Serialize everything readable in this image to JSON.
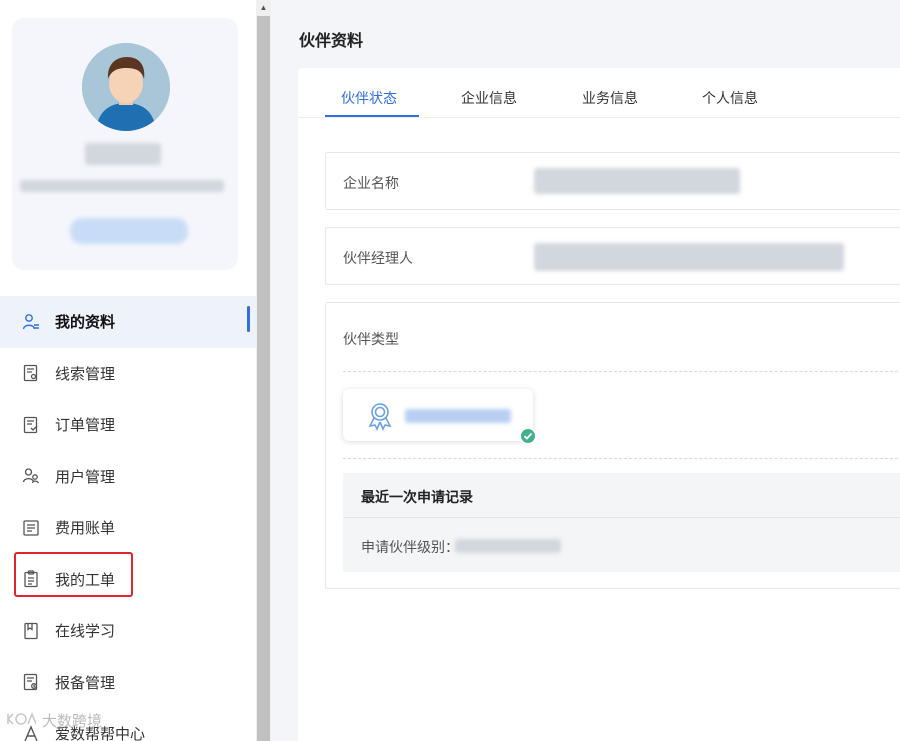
{
  "sidebar": {
    "menu": [
      {
        "label": "我的资料",
        "icon": "user-profile-icon",
        "active": true
      },
      {
        "label": "线索管理",
        "icon": "lead-document-icon"
      },
      {
        "label": "订单管理",
        "icon": "order-document-icon"
      },
      {
        "label": "用户管理",
        "icon": "users-icon"
      },
      {
        "label": "费用账单",
        "icon": "bill-icon"
      },
      {
        "label": "我的工单",
        "icon": "clipboard-icon"
      },
      {
        "label": "在线学习",
        "icon": "book-icon"
      },
      {
        "label": "报备管理",
        "icon": "report-document-icon"
      },
      {
        "label": "爱数帮帮中心",
        "icon": "help-center-icon"
      }
    ],
    "watermark": "大数跨境"
  },
  "main": {
    "page_title": "伙伴资料",
    "tabs": [
      {
        "label": "伙伴状态",
        "active": true
      },
      {
        "label": "企业信息"
      },
      {
        "label": "业务信息"
      },
      {
        "label": "个人信息"
      }
    ],
    "fields": {
      "company_name_label": "企业名称",
      "partner_manager_label": "伙伴经理人",
      "partner_type_label": "伙伴类型"
    },
    "record": {
      "title": "最近一次申请记录",
      "level_label": "申请伙伴级别："
    }
  },
  "colors": {
    "accent": "#2f6fe0",
    "highlight_box": "#e0262a",
    "check_badge": "#43b18a"
  }
}
